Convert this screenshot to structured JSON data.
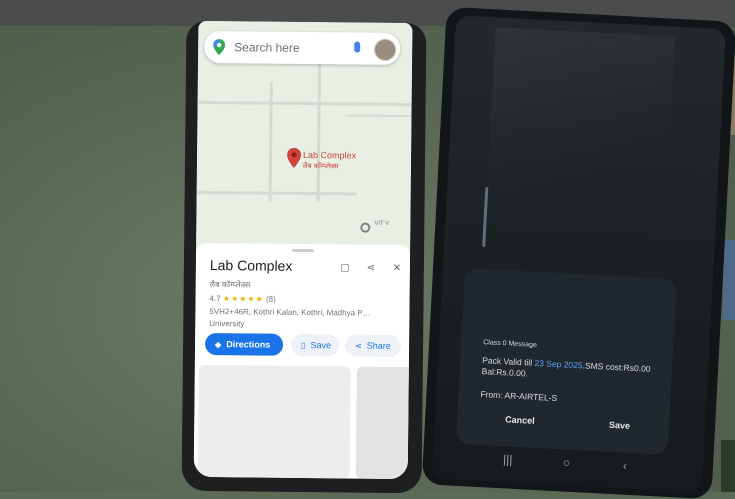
{
  "map_app": {
    "search_placeholder": "Search here",
    "marker_label": "Lab Complex",
    "marker_sublabel": "लैब कॉम्प्लेक्स",
    "edge_label": "VIT V",
    "place": {
      "title": "Lab Complex",
      "subtitle": "लैब कॉम्प्लेक्स",
      "rating": "4.7",
      "stars": "★★★★★",
      "review_count": "(8)",
      "address": "5VH2+46R, Kothri Kalan, Kothri, Madhya P…",
      "category": "University"
    },
    "actions": {
      "directions": "Directions",
      "save": "Save",
      "share": "Share"
    },
    "icons": {
      "bookmark": "bookmark-icon",
      "share": "share-icon",
      "close": "close-icon"
    }
  },
  "sms_dialog": {
    "title": "Class 0 Message",
    "body_prefix": "Pack Valid till ",
    "valid_date": "23 Sep 2025",
    "body_suffix": ".SMS cost:Rs0.00 Bal:Rs.0.00.",
    "from": "From: AR-AIRTEL-S",
    "cancel": "Cancel",
    "save": "Save"
  },
  "colors": {
    "accent_blue": "#1a73e8",
    "marker_red": "#d0443b",
    "star_yellow": "#f0b400"
  }
}
